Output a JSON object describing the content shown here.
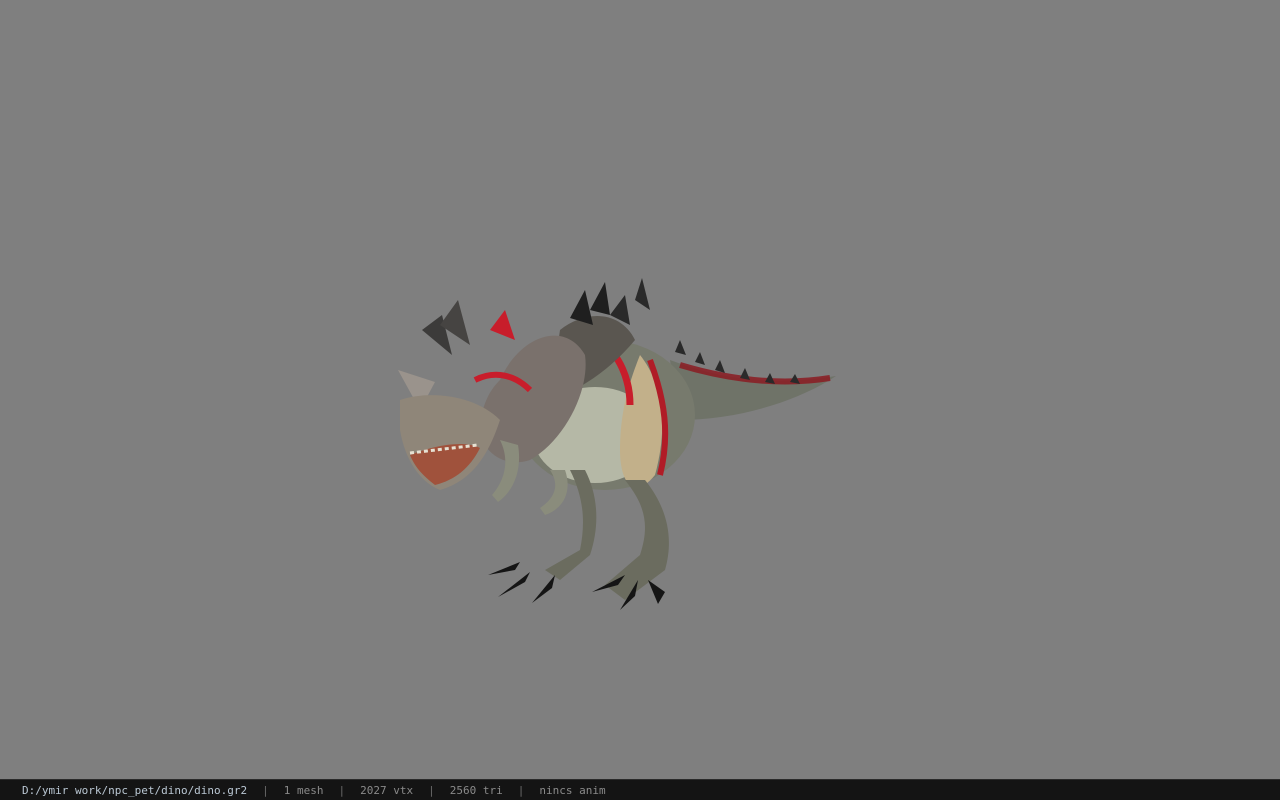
{
  "viewport": {
    "background_color": "#7f7f7f",
    "model_name": "dino"
  },
  "statusbar": {
    "file_path": "D:/ymir work/npc_pet/dino/dino.gr2",
    "separator": "|",
    "mesh_count": "1 mesh",
    "vertex_count": "2027 vtx",
    "triangle_count": "2560 tri",
    "anim_status": "nincs anim"
  }
}
